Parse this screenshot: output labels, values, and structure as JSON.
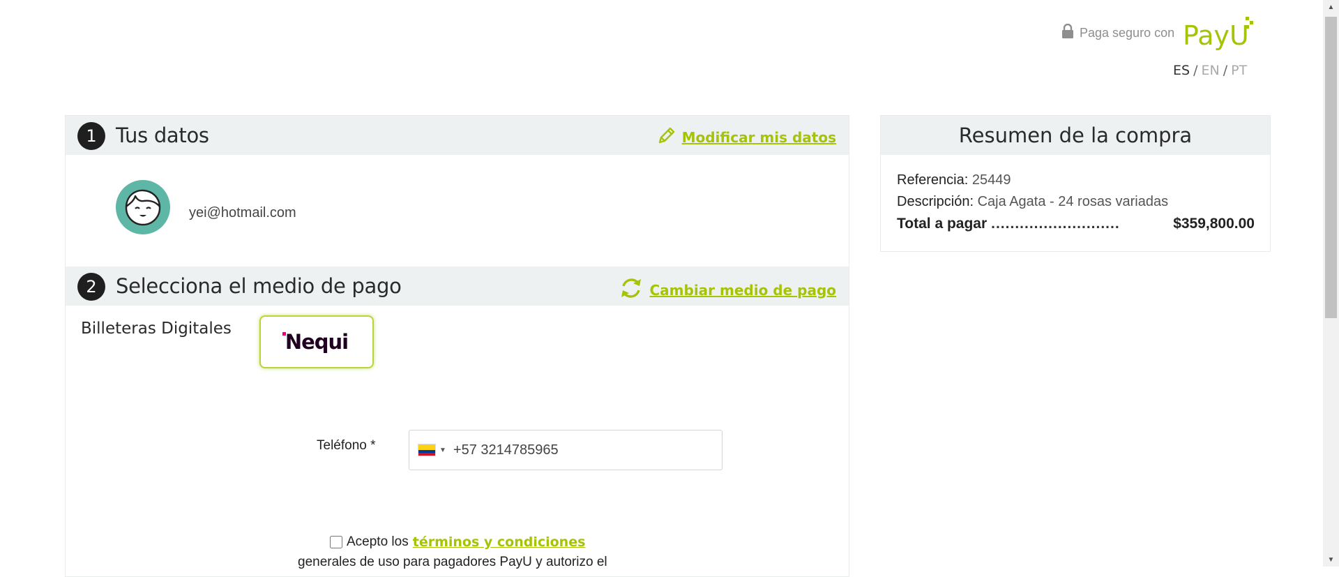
{
  "header": {
    "secure_text": "Paga seguro con",
    "brand": "PayU",
    "languages": [
      "ES",
      "EN",
      "PT"
    ],
    "active_language": "ES"
  },
  "step1": {
    "number": "1",
    "title": "Tus datos",
    "edit_link": "Modificar mis datos",
    "email": "yei@hotmail.com"
  },
  "step2": {
    "number": "2",
    "title": "Selecciona el medio de pago",
    "change_link": "Cambiar medio de pago",
    "category_label": "Billeteras Digitales",
    "selected_method": "Nequi",
    "phone_label": "Teléfono *",
    "phone_value": "+57 3214785965",
    "terms_prefix": "Acepto los",
    "terms_link": "términos y condiciones",
    "terms_line2": "generales de uso para pagadores PayU y autorizo el"
  },
  "summary": {
    "title": "Resumen de la compra",
    "reference_label": "Referencia:",
    "reference_value": "25449",
    "description_label": "Descripción:",
    "description_value": "Caja Agata - 24 rosas variadas",
    "total_label": "Total a pagar",
    "total_dots": "...........................",
    "total_value": "$359,800.00"
  },
  "colors": {
    "accent": "#a6c307",
    "section_header_bg": "#edf1f2",
    "avatar_bg": "#5eb7a6",
    "nequi_pink": "#e4007c"
  },
  "icons": [
    "lock-icon",
    "pencil-icon",
    "refresh-icon",
    "avatar-icon",
    "colombia-flag-icon"
  ]
}
